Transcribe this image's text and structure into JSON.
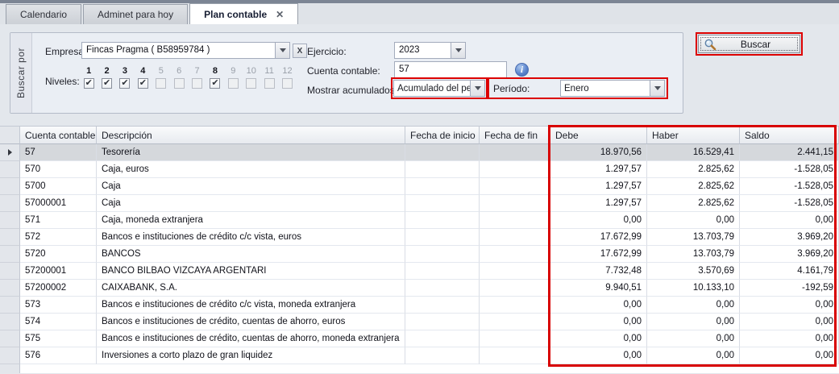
{
  "icons": {
    "close": "✕",
    "check": "✔",
    "clear": "X",
    "info": "i"
  },
  "colors": {
    "highlight_red": "#dc0000",
    "selected_row_bg": "#d5d8dc",
    "panel_bg": "#eaeef4"
  },
  "window": {
    "tabs": [
      {
        "label": "Calendario"
      },
      {
        "label": "Adminet para hoy"
      },
      {
        "label": "Plan contable"
      }
    ]
  },
  "filter": {
    "panel_tab": "Buscar por",
    "empresa_label": "Empresa:",
    "empresa_value": "Fincas Pragma ( B58959784 )",
    "niveles_label": "Niveles:",
    "niveles": [
      {
        "n": "1",
        "checked": true,
        "enabled": true
      },
      {
        "n": "2",
        "checked": true,
        "enabled": true
      },
      {
        "n": "3",
        "checked": true,
        "enabled": true
      },
      {
        "n": "4",
        "checked": true,
        "enabled": true
      },
      {
        "n": "5",
        "checked": false,
        "enabled": false
      },
      {
        "n": "6",
        "checked": false,
        "enabled": false
      },
      {
        "n": "7",
        "checked": false,
        "enabled": false
      },
      {
        "n": "8",
        "checked": true,
        "enabled": true
      },
      {
        "n": "9",
        "checked": false,
        "enabled": false
      },
      {
        "n": "10",
        "checked": false,
        "enabled": false
      },
      {
        "n": "11",
        "checked": false,
        "enabled": false
      },
      {
        "n": "12",
        "checked": false,
        "enabled": false
      }
    ],
    "ejercicio_label": "Ejercicio:",
    "ejercicio_value": "2023",
    "cuenta_label": "Cuenta contable:",
    "cuenta_value": "57",
    "acumulados_label": "Mostrar acumulados:",
    "acumulados_value": "Acumulado del período",
    "periodo_label": "Período:",
    "periodo_value": "Enero",
    "buscar_label": "Buscar"
  },
  "grid": {
    "columns": [
      "Cuenta contable",
      "Descripción",
      "Fecha de inicio",
      "Fecha de fin",
      "Debe",
      "Haber",
      "Saldo"
    ],
    "sort": {
      "column": "Cuenta contable",
      "direction": "asc"
    },
    "rows": [
      {
        "cuenta": "57",
        "descripcion": "Tesorería",
        "fecha_inicio": "",
        "fecha_fin": "",
        "debe": "18.970,56",
        "haber": "16.529,41",
        "saldo": "2.441,15",
        "selected": true
      },
      {
        "cuenta": "570",
        "descripcion": "Caja, euros",
        "fecha_inicio": "",
        "fecha_fin": "",
        "debe": "1.297,57",
        "haber": "2.825,62",
        "saldo": "-1.528,05"
      },
      {
        "cuenta": "5700",
        "descripcion": "Caja",
        "fecha_inicio": "",
        "fecha_fin": "",
        "debe": "1.297,57",
        "haber": "2.825,62",
        "saldo": "-1.528,05"
      },
      {
        "cuenta": "57000001",
        "descripcion": "Caja",
        "fecha_inicio": "",
        "fecha_fin": "",
        "debe": "1.297,57",
        "haber": "2.825,62",
        "saldo": "-1.528,05"
      },
      {
        "cuenta": "571",
        "descripcion": "Caja, moneda extranjera",
        "fecha_inicio": "",
        "fecha_fin": "",
        "debe": "0,00",
        "haber": "0,00",
        "saldo": "0,00"
      },
      {
        "cuenta": "572",
        "descripcion": "Bancos e instituciones de crédito c/c vista, euros",
        "fecha_inicio": "",
        "fecha_fin": "",
        "debe": "17.672,99",
        "haber": "13.703,79",
        "saldo": "3.969,20"
      },
      {
        "cuenta": "5720",
        "descripcion": "BANCOS",
        "fecha_inicio": "",
        "fecha_fin": "",
        "debe": "17.672,99",
        "haber": "13.703,79",
        "saldo": "3.969,20"
      },
      {
        "cuenta": "57200001",
        "descripcion": "BANCO BILBAO VIZCAYA ARGENTARI",
        "fecha_inicio": "",
        "fecha_fin": "",
        "debe": "7.732,48",
        "haber": "3.570,69",
        "saldo": "4.161,79"
      },
      {
        "cuenta": "57200002",
        "descripcion": "CAIXABANK, S.A.",
        "fecha_inicio": "",
        "fecha_fin": "",
        "debe": "9.940,51",
        "haber": "10.133,10",
        "saldo": "-192,59"
      },
      {
        "cuenta": "573",
        "descripcion": "Bancos e instituciones de crédito c/c vista, moneda extranjera",
        "fecha_inicio": "",
        "fecha_fin": "",
        "debe": "0,00",
        "haber": "0,00",
        "saldo": "0,00"
      },
      {
        "cuenta": "574",
        "descripcion": "Bancos e instituciones de crédito, cuentas de ahorro, euros",
        "fecha_inicio": "",
        "fecha_fin": "",
        "debe": "0,00",
        "haber": "0,00",
        "saldo": "0,00"
      },
      {
        "cuenta": "575",
        "descripcion": "Bancos e instituciones de crédito, cuentas de ahorro, moneda extranjera",
        "fecha_inicio": "",
        "fecha_fin": "",
        "debe": "0,00",
        "haber": "0,00",
        "saldo": "0,00"
      },
      {
        "cuenta": "576",
        "descripcion": "Inversiones a corto plazo de gran liquidez",
        "fecha_inicio": "",
        "fecha_fin": "",
        "debe": "0,00",
        "haber": "0,00",
        "saldo": "0,00"
      }
    ]
  }
}
